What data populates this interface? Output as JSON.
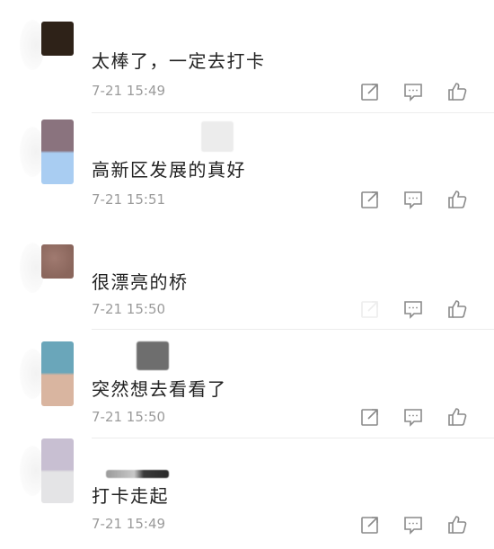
{
  "comments": [
    {
      "text": "太棒了，一定去打卡",
      "time": "7-21 15:49"
    },
    {
      "text": "高新区发展的真好",
      "time": "7-21 15:51"
    },
    {
      "text": "很漂亮的桥",
      "time": "7-21 15:50"
    },
    {
      "text": "突然想去看看了",
      "time": "7-21 15:50"
    },
    {
      "text": "打卡走起",
      "time": "7-21 15:49"
    }
  ],
  "icons": {
    "share": "share-edit-icon",
    "reply": "comment-bubble-icon",
    "like": "thumbs-up-icon"
  },
  "colors": {
    "text": "#222222",
    "time": "#9b9b9b",
    "icon": "#8a8a8a",
    "divider": "#ececec"
  }
}
